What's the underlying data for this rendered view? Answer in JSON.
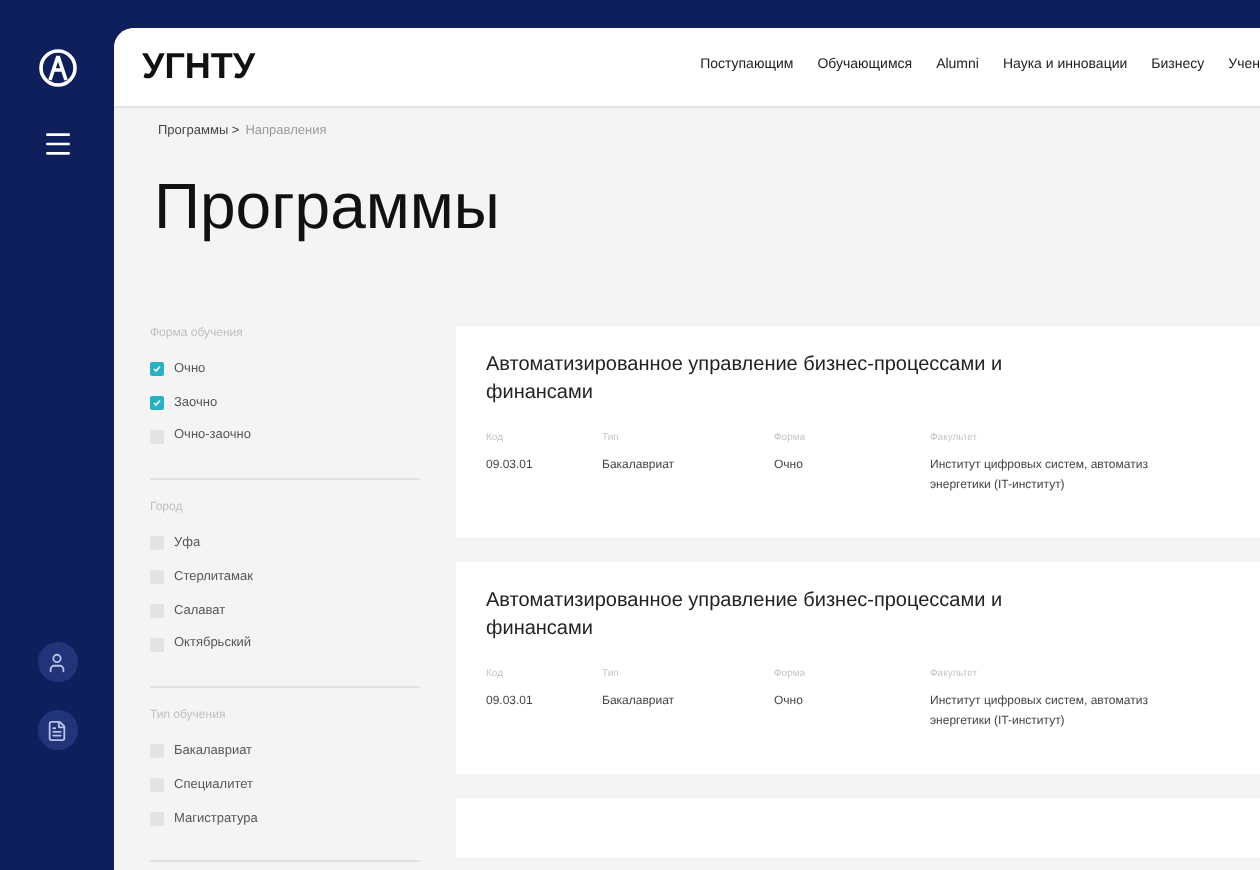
{
  "header": {
    "brand": "УГНТУ",
    "nav": [
      "Поступающим",
      "Обучающимся",
      "Alumni",
      "Наука и инновации",
      "Бизнесу",
      "Учен"
    ]
  },
  "breadcrumb": {
    "items": [
      "Программы >",
      "Направления"
    ]
  },
  "page_title": "Программы",
  "filters": [
    {
      "title": "Форма обучения",
      "options": [
        {
          "label": "Очно",
          "checked": true
        },
        {
          "label": "Заочно",
          "checked": true
        },
        {
          "label": "Очно-заочно",
          "checked": false
        }
      ]
    },
    {
      "title": "Город",
      "options": [
        {
          "label": "Уфа",
          "checked": false
        },
        {
          "label": "Стерлитамак",
          "checked": false
        },
        {
          "label": "Салават",
          "checked": false
        },
        {
          "label": "Октябрьский",
          "checked": false
        }
      ]
    },
    {
      "title": "Тип обучения",
      "options": [
        {
          "label": "Бакалавриат",
          "checked": false
        },
        {
          "label": "Специалитет",
          "checked": false
        },
        {
          "label": "Магистратура",
          "checked": false
        }
      ]
    }
  ],
  "programs": [
    {
      "title": "Автоматизированное управление бизнес-процессами и финансами",
      "fields": [
        {
          "label": "Код",
          "value": "09.03.01"
        },
        {
          "label": "Тип",
          "value": "Бакалавриат"
        },
        {
          "label": "Форма",
          "value": "Очно"
        },
        {
          "label": "Факультет",
          "value": "Институт цифровых систем, автоматиз энергетики (IT-институт)"
        }
      ]
    },
    {
      "title": "Автоматизированное управление бизнес-процессами и финансами",
      "fields": [
        {
          "label": "Код",
          "value": "09.03.01"
        },
        {
          "label": "Тип",
          "value": "Бакалавриат"
        },
        {
          "label": "Форма",
          "value": "Очно"
        },
        {
          "label": "Факультет",
          "value": "Институт цифровых систем, автоматиз энергетики (IT-институт)"
        }
      ]
    }
  ]
}
